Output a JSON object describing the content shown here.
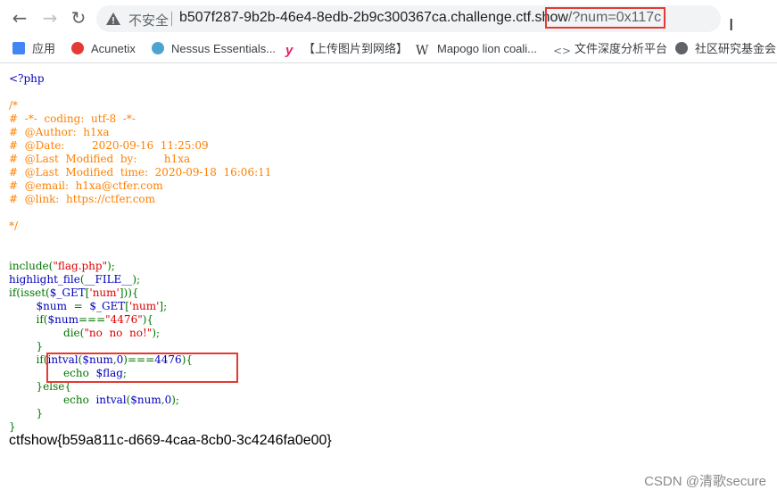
{
  "browser": {
    "insecure_label": "不安全",
    "url_host": "b507f287-9b2b-46e4-8edb-2b9c300367ca.challenge.ctf.show",
    "url_query": "/?num=0x117c"
  },
  "bookmarks": [
    {
      "label": "应用",
      "icon": "apps-grid-icon",
      "color": "#4285f4"
    },
    {
      "label": "Acunetix",
      "icon": "acunetix-icon",
      "color": "#e53935"
    },
    {
      "label": "Nessus Essentials...",
      "icon": "nessus-icon",
      "color": "#4fa3d1"
    },
    {
      "label": "【上传图片到网络】",
      "icon": "y-logo-icon",
      "color": "#e91e63"
    },
    {
      "label": "Mapogo lion coali...",
      "icon": "wikipedia-icon",
      "color": "#333333"
    },
    {
      "label": "文件深度分析平台",
      "icon": "link-icon",
      "color": "#6e7781"
    },
    {
      "label": "社区研究基金会",
      "icon": "globe-icon",
      "color": "#5f6368"
    }
  ],
  "code_lines": [
    [
      {
        "t": "<?php",
        "c": "def"
      }
    ],
    [
      {
        "t": "",
        "c": "def"
      }
    ],
    [
      {
        "t": "/*",
        "c": "cm"
      }
    ],
    [
      {
        "t": "#  -*-  coding:  utf-8  -*-",
        "c": "cm"
      }
    ],
    [
      {
        "t": "#  @Author:  h1xa",
        "c": "cm"
      }
    ],
    [
      {
        "t": "#  @Date:        2020-09-16  11:25:09",
        "c": "cm"
      }
    ],
    [
      {
        "t": "#  @Last  Modified  by:        h1xa",
        "c": "cm"
      }
    ],
    [
      {
        "t": "#  @Last  Modified  time:  2020-09-18  16:06:11",
        "c": "cm"
      }
    ],
    [
      {
        "t": "#  @email:  h1xa@ctfer.com",
        "c": "cm"
      }
    ],
    [
      {
        "t": "#  @link:  https://ctfer.com",
        "c": "cm"
      }
    ],
    [
      {
        "t": "",
        "c": "def"
      }
    ],
    [
      {
        "t": "*/",
        "c": "cm"
      }
    ],
    [
      {
        "t": "",
        "c": "def"
      }
    ],
    [
      {
        "t": "",
        "c": "def"
      }
    ],
    [
      {
        "t": "include",
        "c": "kw"
      },
      {
        "t": "(",
        "c": "kw"
      },
      {
        "t": "\"flag.php\"",
        "c": "st"
      },
      {
        "t": ");",
        "c": "kw"
      }
    ],
    [
      {
        "t": "highlight_file",
        "c": "def"
      },
      {
        "t": "(",
        "c": "kw"
      },
      {
        "t": "__FILE__",
        "c": "def"
      },
      {
        "t": ");",
        "c": "kw"
      }
    ],
    [
      {
        "t": "if(",
        "c": "kw"
      },
      {
        "t": "isset",
        "c": "kw"
      },
      {
        "t": "(",
        "c": "kw"
      },
      {
        "t": "$_GET",
        "c": "def"
      },
      {
        "t": "[",
        "c": "kw"
      },
      {
        "t": "'num'",
        "c": "st"
      },
      {
        "t": "])){",
        "c": "kw"
      }
    ],
    [
      {
        "t": "        ",
        "c": "def"
      },
      {
        "t": "$num  ",
        "c": "def"
      },
      {
        "t": "=  ",
        "c": "kw"
      },
      {
        "t": "$_GET",
        "c": "def"
      },
      {
        "t": "[",
        "c": "kw"
      },
      {
        "t": "'num'",
        "c": "st"
      },
      {
        "t": "];",
        "c": "kw"
      }
    ],
    [
      {
        "t": "        ",
        "c": "def"
      },
      {
        "t": "if(",
        "c": "kw"
      },
      {
        "t": "$num",
        "c": "def"
      },
      {
        "t": "===",
        "c": "kw"
      },
      {
        "t": "\"4476\"",
        "c": "st"
      },
      {
        "t": "){",
        "c": "kw"
      }
    ],
    [
      {
        "t": "                ",
        "c": "def"
      },
      {
        "t": "die",
        "c": "kw"
      },
      {
        "t": "(",
        "c": "kw"
      },
      {
        "t": "\"no  no  no!\"",
        "c": "st"
      },
      {
        "t": ");",
        "c": "kw"
      }
    ],
    [
      {
        "t": "        ",
        "c": "def"
      },
      {
        "t": "}",
        "c": "kw"
      }
    ],
    [
      {
        "t": "        ",
        "c": "def"
      },
      {
        "t": "if(",
        "c": "kw"
      },
      {
        "t": "intval",
        "c": "def"
      },
      {
        "t": "(",
        "c": "kw"
      },
      {
        "t": "$num",
        "c": "def"
      },
      {
        "t": ",",
        "c": "kw"
      },
      {
        "t": "0",
        "c": "def"
      },
      {
        "t": ")===",
        "c": "kw"
      },
      {
        "t": "4476",
        "c": "def"
      },
      {
        "t": "){",
        "c": "kw"
      }
    ],
    [
      {
        "t": "                ",
        "c": "def"
      },
      {
        "t": "echo  ",
        "c": "kw"
      },
      {
        "t": "$flag",
        "c": "def"
      },
      {
        "t": ";",
        "c": "kw"
      }
    ],
    [
      {
        "t": "        ",
        "c": "def"
      },
      {
        "t": "}else{",
        "c": "kw"
      }
    ],
    [
      {
        "t": "                ",
        "c": "def"
      },
      {
        "t": "echo  ",
        "c": "kw"
      },
      {
        "t": "intval",
        "c": "def"
      },
      {
        "t": "(",
        "c": "kw"
      },
      {
        "t": "$num",
        "c": "def"
      },
      {
        "t": ",",
        "c": "kw"
      },
      {
        "t": "0",
        "c": "def"
      },
      {
        "t": ");",
        "c": "kw"
      }
    ],
    [
      {
        "t": "        ",
        "c": "def"
      },
      {
        "t": "}",
        "c": "kw"
      }
    ],
    [
      {
        "t": "}",
        "c": "kw"
      }
    ]
  ],
  "output": {
    "flag": "ctfshow{b59a811c-d669-4caa-8cb0-3c4246fa0e00}"
  },
  "watermark": "CSDN @清歌secure",
  "colors": {
    "highlight_red": "#e53935",
    "php_keyword": "#007700",
    "php_comment": "#ff8000",
    "php_string": "#dd0000",
    "php_default": "#0000bb"
  }
}
